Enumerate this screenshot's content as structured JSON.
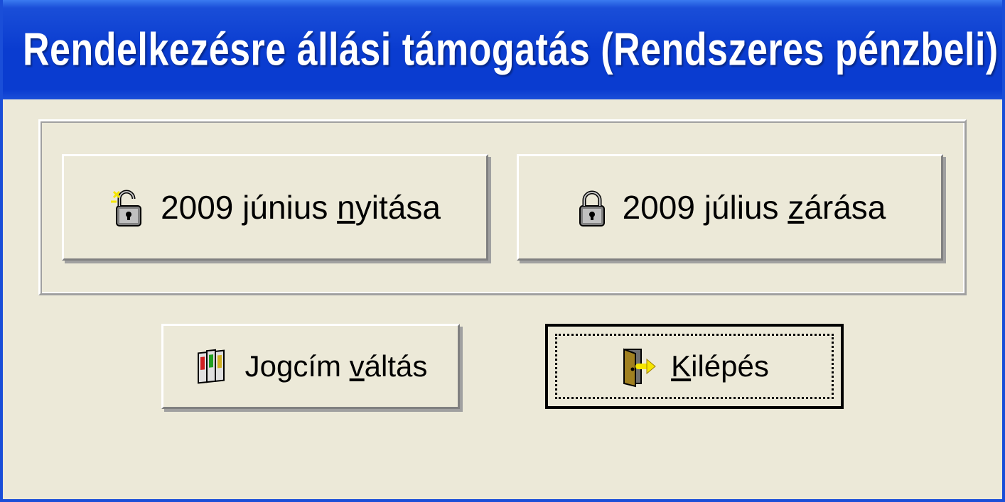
{
  "window": {
    "title": "Rendelkezésre állási támogatás (Rendszeres pénzbeli)"
  },
  "buttons": {
    "open_month": {
      "prefix": "2009 június ",
      "accel": "n",
      "suffix": "yitása"
    },
    "close_month": {
      "prefix": "2009 július ",
      "accel": "z",
      "suffix": "árása"
    },
    "switch_title": {
      "prefix": "Jogcím ",
      "accel": "v",
      "suffix": "áltás"
    },
    "exit": {
      "prefix": "",
      "accel": "K",
      "suffix": "ilépés"
    }
  }
}
